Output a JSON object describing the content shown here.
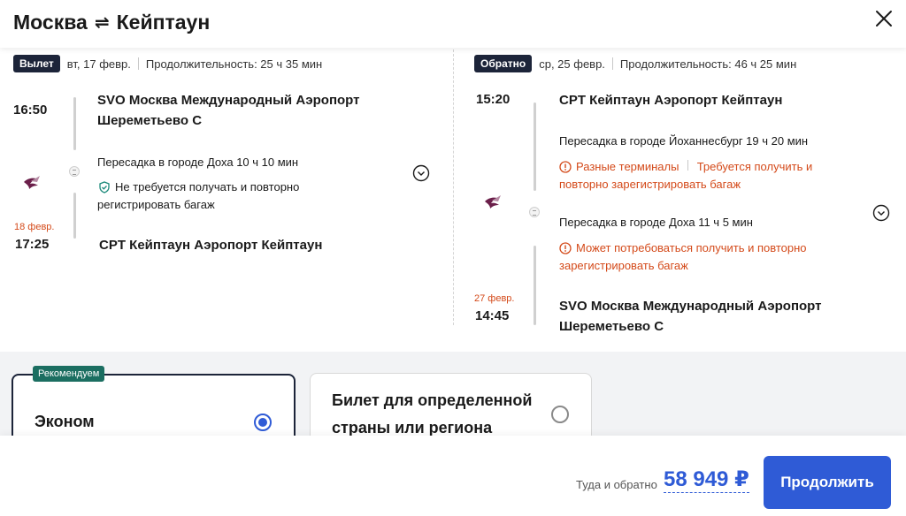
{
  "header": {
    "origin": "Москва",
    "arrows": "⇌",
    "destination": "Кейптаун",
    "close_icon": "close-icon"
  },
  "outbound": {
    "chip": "Вылет",
    "date": "вт, 17 февр.",
    "duration": "Продолжительность: 25 ч 35 мин",
    "dep_time": "16:50",
    "dep_airport": [
      "SVO Москва Международный Аэропорт",
      "Шереметьево С"
    ],
    "transfer": "Пересадка в городе Доха   10 ч 10 мин",
    "baggage_note": [
      "Не требуется получать и повторно",
      "регистрировать багаж"
    ],
    "arr_date_note": "18 февр.",
    "arr_time": "17:25",
    "arr_airport": "CPT Кейптаун Аэропорт Кейптаун"
  },
  "inbound": {
    "chip": "Обратно",
    "date": "ср, 25 февр.",
    "duration": "Продолжительность: 46 ч 25 мин",
    "dep_time": "15:20",
    "dep_airport": "CPT Кейптаун Аэропорт Кейптаун",
    "transfer1": "Пересадка в городе Йоханнесбург   19 ч 20 мин",
    "warn1": [
      "Разные терминалы",
      "Требуется получить и",
      "повторно зарегистрировать багаж"
    ],
    "transfer2": "Пересадка в городе Доха   11 ч 5 мин",
    "warn2": [
      "Может потребоваться получить и повторно",
      "зарегистрировать багаж"
    ],
    "arr_date_note": "27 февр.",
    "arr_time": "14:45",
    "arr_airport": [
      "SVO Москва Международный Аэропорт",
      "Шереметьево С"
    ]
  },
  "tariffs": {
    "badge": "Рекомендуем",
    "card1_title": "Эконом",
    "card2_title": [
      "Билет для определенной",
      "страны или региона"
    ]
  },
  "footer": {
    "total_label": "Туда и обратно",
    "price": "58 949 ₽",
    "continue_label": "Продолжить"
  },
  "colors": {
    "accent": "#2f5bd6",
    "warning": "#d44a1a",
    "chip": "#1c2439",
    "badge": "#1b6e61"
  }
}
